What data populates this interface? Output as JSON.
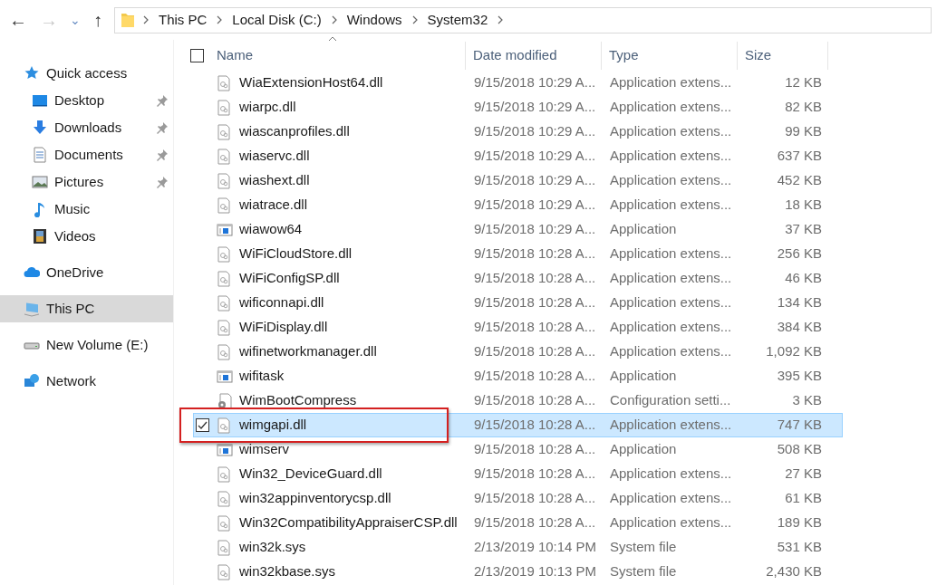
{
  "navigation": {
    "back": "←",
    "forward": "→",
    "recent": "⌄",
    "up": "↑"
  },
  "address_bar": {
    "segments": [
      "This PC",
      "Local Disk (C:)",
      "Windows",
      "System32"
    ]
  },
  "sidebar": {
    "items": [
      {
        "label": "Quick access",
        "kind": "star",
        "selected": false,
        "children": [
          {
            "label": "Desktop",
            "kind": "desktop",
            "pinned": true,
            "selected": false
          },
          {
            "label": "Downloads",
            "kind": "download",
            "pinned": true,
            "selected": false
          },
          {
            "label": "Documents",
            "kind": "document",
            "pinned": true,
            "selected": false
          },
          {
            "label": "Pictures",
            "kind": "picture",
            "pinned": true,
            "selected": false
          },
          {
            "label": "Music",
            "kind": "music",
            "pinned": false,
            "selected": false
          },
          {
            "label": "Videos",
            "kind": "video",
            "pinned": false,
            "selected": false
          }
        ]
      },
      {
        "label": "OneDrive",
        "kind": "cloud",
        "selected": false
      },
      {
        "label": "This PC",
        "kind": "computer",
        "selected": true
      },
      {
        "label": "New Volume (E:)",
        "kind": "drive",
        "selected": false
      },
      {
        "label": "Network",
        "kind": "network",
        "selected": false
      }
    ]
  },
  "table": {
    "select_all_checked": false,
    "columns": [
      "Name",
      "Date modified",
      "Type",
      "Size"
    ],
    "rows": [
      {
        "name": "WiaExtensionHost64.dll",
        "date": "9/15/2018 10:29 A...",
        "type": "Application extens...",
        "size": "12 KB",
        "kind": "extension",
        "selected": false,
        "annotated": false
      },
      {
        "name": "wiarpc.dll",
        "date": "9/15/2018 10:29 A...",
        "type": "Application extens...",
        "size": "82 KB",
        "kind": "extension",
        "selected": false,
        "annotated": false
      },
      {
        "name": "wiascanprofiles.dll",
        "date": "9/15/2018 10:29 A...",
        "type": "Application extens...",
        "size": "99 KB",
        "kind": "extension",
        "selected": false,
        "annotated": false
      },
      {
        "name": "wiaservc.dll",
        "date": "9/15/2018 10:29 A...",
        "type": "Application extens...",
        "size": "637 KB",
        "kind": "extension",
        "selected": false,
        "annotated": false
      },
      {
        "name": "wiashext.dll",
        "date": "9/15/2018 10:29 A...",
        "type": "Application extens...",
        "size": "452 KB",
        "kind": "extension",
        "selected": false,
        "annotated": false
      },
      {
        "name": "wiatrace.dll",
        "date": "9/15/2018 10:29 A...",
        "type": "Application extens...",
        "size": "18 KB",
        "kind": "extension",
        "selected": false,
        "annotated": false
      },
      {
        "name": "wiawow64",
        "date": "9/15/2018 10:29 A...",
        "type": "Application",
        "size": "37 KB",
        "kind": "application",
        "selected": false,
        "annotated": false
      },
      {
        "name": "WiFiCloudStore.dll",
        "date": "9/15/2018 10:28 A...",
        "type": "Application extens...",
        "size": "256 KB",
        "kind": "extension",
        "selected": false,
        "annotated": false
      },
      {
        "name": "WiFiConfigSP.dll",
        "date": "9/15/2018 10:28 A...",
        "type": "Application extens...",
        "size": "46 KB",
        "kind": "extension",
        "selected": false,
        "annotated": false
      },
      {
        "name": "wificonnapi.dll",
        "date": "9/15/2018 10:28 A...",
        "type": "Application extens...",
        "size": "134 KB",
        "kind": "extension",
        "selected": false,
        "annotated": false
      },
      {
        "name": "WiFiDisplay.dll",
        "date": "9/15/2018 10:28 A...",
        "type": "Application extens...",
        "size": "384 KB",
        "kind": "extension",
        "selected": false,
        "annotated": false
      },
      {
        "name": "wifinetworkmanager.dll",
        "date": "9/15/2018 10:28 A...",
        "type": "Application extens...",
        "size": "1,092 KB",
        "kind": "extension",
        "selected": false,
        "annotated": false
      },
      {
        "name": "wifitask",
        "date": "9/15/2018 10:28 A...",
        "type": "Application",
        "size": "395 KB",
        "kind": "application",
        "selected": false,
        "annotated": false
      },
      {
        "name": "WimBootCompress",
        "date": "9/15/2018 10:28 A...",
        "type": "Configuration setti...",
        "size": "3 KB",
        "kind": "settings",
        "selected": false,
        "annotated": false
      },
      {
        "name": "wimgapi.dll",
        "date": "9/15/2018 10:28 A...",
        "type": "Application extens...",
        "size": "747 KB",
        "kind": "extension",
        "selected": true,
        "annotated": true
      },
      {
        "name": "wimserv",
        "date": "9/15/2018 10:28 A...",
        "type": "Application",
        "size": "508 KB",
        "kind": "application",
        "selected": false,
        "annotated": false
      },
      {
        "name": "Win32_DeviceGuard.dll",
        "date": "9/15/2018 10:28 A...",
        "type": "Application extens...",
        "size": "27 KB",
        "kind": "extension",
        "selected": false,
        "annotated": false
      },
      {
        "name": "win32appinventorycsp.dll",
        "date": "9/15/2018 10:28 A...",
        "type": "Application extens...",
        "size": "61 KB",
        "kind": "extension",
        "selected": false,
        "annotated": false
      },
      {
        "name": "Win32CompatibilityAppraiserCSP.dll",
        "date": "9/15/2018 10:28 A...",
        "type": "Application extens...",
        "size": "189 KB",
        "kind": "extension",
        "selected": false,
        "annotated": false
      },
      {
        "name": "win32k.sys",
        "date": "2/13/2019 10:14 PM",
        "type": "System file",
        "size": "531 KB",
        "kind": "extension",
        "selected": false,
        "annotated": false
      },
      {
        "name": "win32kbase.sys",
        "date": "2/13/2019 10:13 PM",
        "type": "System file",
        "size": "2,430 KB",
        "kind": "extension",
        "selected": false,
        "annotated": false
      }
    ]
  }
}
